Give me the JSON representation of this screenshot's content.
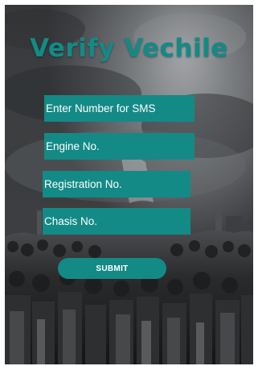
{
  "colors": {
    "accent": "#138a86",
    "field_text": "#ffffff",
    "title": "#138a86",
    "button_text": "#ffffff"
  },
  "header": {
    "title": "Verify Vechile"
  },
  "form": {
    "fields": [
      {
        "placeholder": "Enter Number for SMS"
      },
      {
        "placeholder": "Engine No."
      },
      {
        "placeholder": "Registration No."
      },
      {
        "placeholder": "Chasis No."
      }
    ],
    "submit_label": "SUBMIT"
  }
}
